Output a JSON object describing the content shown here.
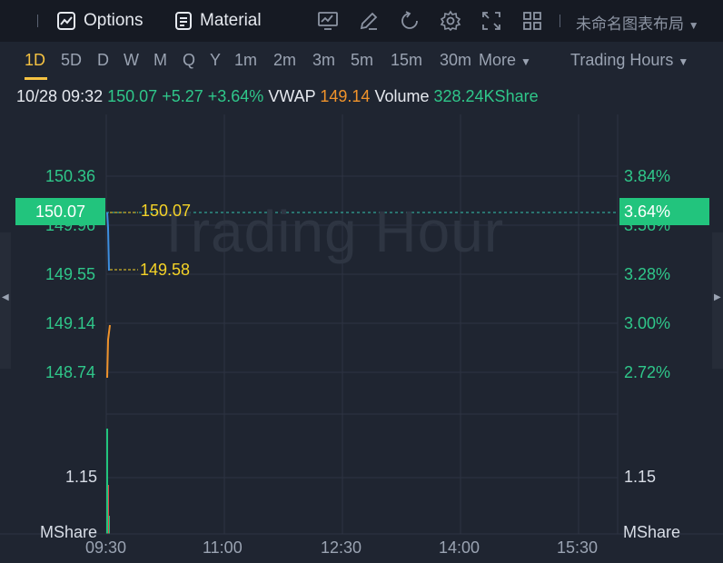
{
  "toolbar": {
    "options_label": "Options",
    "material_label": "Material",
    "layout_name": "未命名图表布局"
  },
  "timeframes": [
    "1D",
    "5D",
    "D",
    "W",
    "M",
    "Q",
    "Y",
    "1m",
    "2m",
    "3m",
    "5m",
    "15m",
    "30m"
  ],
  "timeframe_active": "1D",
  "more_label": "More",
  "trading_hours_label": "Trading Hours",
  "quote": {
    "datetime": "10/28 09:32",
    "price": "150.07",
    "change": "+5.27",
    "change_pct": "+3.64%",
    "vwap_label": "VWAP",
    "vwap": "149.14",
    "volume_label": "Volume",
    "volume": "328.24KShare"
  },
  "price_axis": [
    "150.36",
    "149.96",
    "149.55",
    "149.14",
    "148.74"
  ],
  "pct_axis": [
    "3.84%",
    "3.56%",
    "3.28%",
    "3.00%",
    "2.72%"
  ],
  "volume_axis_left": "1.15",
  "volume_axis_right": "1.15",
  "volume_unit_left": "MShare",
  "volume_unit_right": "MShare",
  "current_price_badge": "150.07",
  "current_pct_badge": "3.64%",
  "hi_marker": "150.07",
  "lo_marker": "149.58",
  "watermark": "Trading Hour",
  "time_axis": [
    "09:30",
    "11:00",
    "12:30",
    "14:00",
    "15:30"
  ],
  "colors": {
    "up": "#2fc78a",
    "vwap": "#f0932b",
    "accent": "#f5c242",
    "price_line": "#3d8fe0",
    "volume_bar": "#22c47d"
  }
}
